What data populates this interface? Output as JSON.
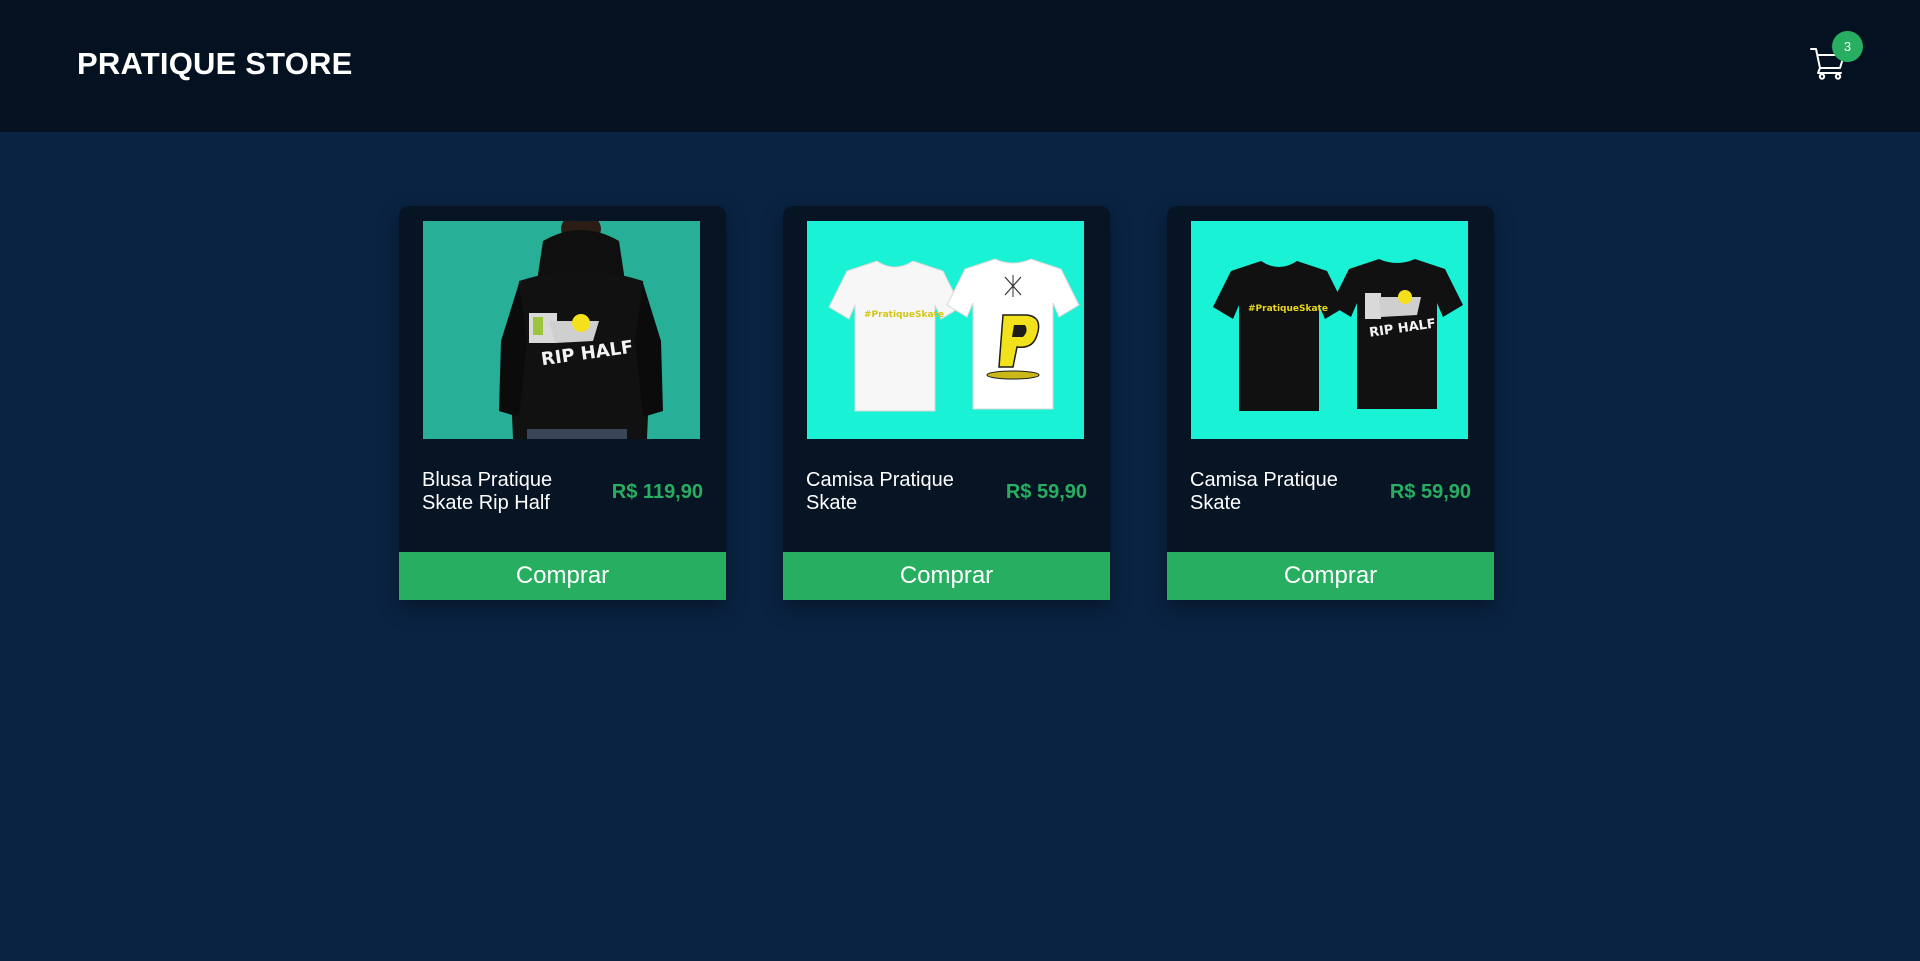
{
  "header": {
    "brand": "PRATIQUE STORE",
    "cart_icon": "shopping-cart-icon",
    "cart_count": "3"
  },
  "colors": {
    "page_background": "#0a2342",
    "header_background": "#041120",
    "card_background": "#061424",
    "accent": "#27ae60"
  },
  "products": [
    {
      "name": "Blusa Pratique Skate Rip Half",
      "price": "R$ 119,90",
      "button_label": "Comprar",
      "image": "black-hoodie-rip-half-photo"
    },
    {
      "name": "Camisa Pratique Skate",
      "price": "R$ 59,90",
      "button_label": "Comprar",
      "image": "white-tshirt-front-back-photo"
    },
    {
      "name": "Camisa Pratique Skate",
      "price": "R$ 59,90",
      "button_label": "Comprar",
      "image": "black-tshirt-front-back-photo"
    }
  ]
}
